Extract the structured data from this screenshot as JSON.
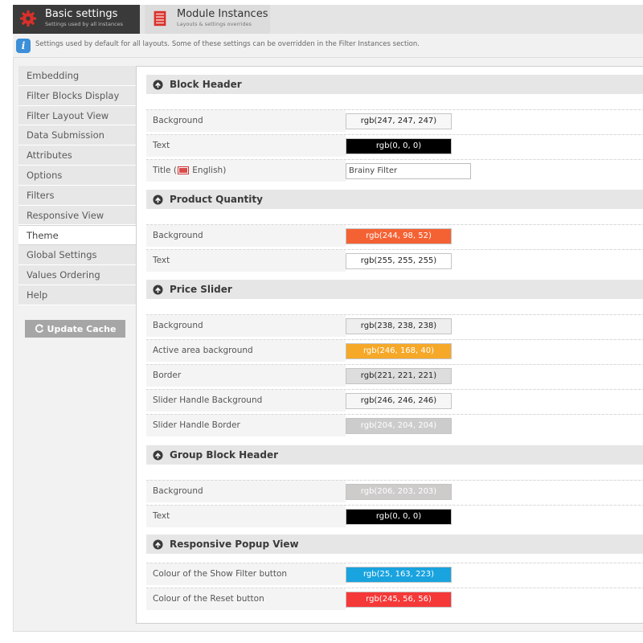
{
  "tabs": {
    "basic": {
      "title": "Basic settings",
      "subtitle": "Settings used by all instances"
    },
    "module": {
      "title": "Module Instances",
      "subtitle": "Layouts & settings overrides"
    }
  },
  "info": {
    "text": "Settings used by default for all layouts. Some of these settings can be overridden in the Filter Instances section."
  },
  "nav": [
    {
      "label": "Embedding",
      "active": false
    },
    {
      "label": "Filter Blocks Display",
      "active": false
    },
    {
      "label": "Filter Layout View",
      "active": false
    },
    {
      "label": "Data Submission",
      "active": false
    },
    {
      "label": "Attributes",
      "active": false
    },
    {
      "label": "Options",
      "active": false
    },
    {
      "label": "Filters",
      "active": false
    },
    {
      "label": "Responsive View",
      "active": false
    },
    {
      "label": "Theme",
      "active": true
    },
    {
      "label": "Global Settings",
      "active": false
    },
    {
      "label": "Values Ordering",
      "active": false
    },
    {
      "label": "Help",
      "active": false
    }
  ],
  "update_cache": {
    "label": "Update Cache"
  },
  "sections": [
    {
      "title": "Block Header",
      "rows": [
        {
          "label": "Background",
          "type": "color",
          "value": "rgb(247, 247, 247)",
          "bg": "#f7f7f7",
          "fg": "#222222"
        },
        {
          "label": "Text",
          "type": "color",
          "value": "rgb(0, 0, 0)",
          "bg": "#000000",
          "fg": "#ffffff"
        },
        {
          "label_pre": "Title (",
          "label_post": " English)",
          "type": "text",
          "value": "Brainy Filter"
        }
      ]
    },
    {
      "title": "Product Quantity",
      "rows": [
        {
          "label": "Background",
          "type": "color",
          "value": "rgb(244, 98, 52)",
          "bg": "#f46234",
          "fg": "#ffffff"
        },
        {
          "label": "Text",
          "type": "color",
          "value": "rgb(255, 255, 255)",
          "bg": "#ffffff",
          "fg": "#222222"
        }
      ]
    },
    {
      "title": "Price Slider",
      "rows": [
        {
          "label": "Background",
          "type": "color",
          "value": "rgb(238, 238, 238)",
          "bg": "#eeeeee",
          "fg": "#222222"
        },
        {
          "label": "Active area background",
          "type": "color",
          "value": "rgb(246, 168, 40)",
          "bg": "#f6a828",
          "fg": "#ffffff"
        },
        {
          "label": "Border",
          "type": "color",
          "value": "rgb(221, 221, 221)",
          "bg": "#dddddd",
          "fg": "#222222"
        },
        {
          "label": "Slider Handle Background",
          "type": "color",
          "value": "rgb(246, 246, 246)",
          "bg": "#f6f6f6",
          "fg": "#222222"
        },
        {
          "label": "Slider Handle Border",
          "type": "color",
          "value": "rgb(204, 204, 204)",
          "bg": "#cccccc",
          "fg": "#ffffff"
        }
      ]
    },
    {
      "title": "Group Block Header",
      "rows": [
        {
          "label": "Background",
          "type": "color",
          "value": "rgb(206, 203, 203)",
          "bg": "#cecbcb",
          "fg": "#ffffff"
        },
        {
          "label": "Text",
          "type": "color",
          "value": "rgb(0, 0, 0)",
          "bg": "#000000",
          "fg": "#ffffff"
        }
      ]
    },
    {
      "title": "Responsive Popup View",
      "rows": [
        {
          "label": "Colour of the Show Filter button",
          "type": "color",
          "value": "rgb(25, 163, 223)",
          "bg": "#19a3df",
          "fg": "#ffffff"
        },
        {
          "label": "Colour of the Reset button",
          "type": "color",
          "value": "rgb(245, 56, 56)",
          "bg": "#f53838",
          "fg": "#ffffff"
        }
      ]
    }
  ]
}
